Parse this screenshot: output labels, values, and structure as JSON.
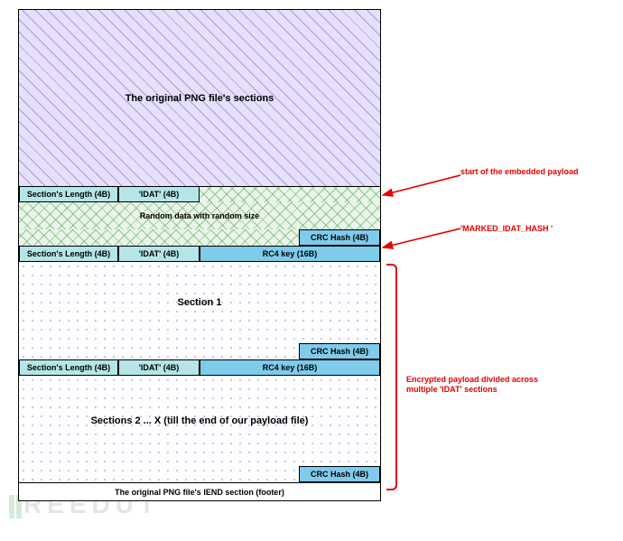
{
  "blocks": {
    "original_png": "The original PNG file's sections",
    "random_data": "Random data with random size",
    "section1": "Section 1",
    "sections_rest": "Sections 2 ... X (till the end of our payload file)",
    "footer": "The original PNG file's IEND section (footer)"
  },
  "cells": {
    "section_length": "Section's Length (4B)",
    "idat": "'IDAT' (4B)",
    "rc4_key": "RC4 key (16B)",
    "crc_hash": "CRC Hash (4B)"
  },
  "annotations": {
    "start_payload": "start of the embedded payload",
    "marked_hash": "'MARKED_IDAT_HASH '",
    "encrypted_note": "Encrypted payload divided across multiple 'IDAT' sections"
  },
  "watermark": "REEDUT"
}
